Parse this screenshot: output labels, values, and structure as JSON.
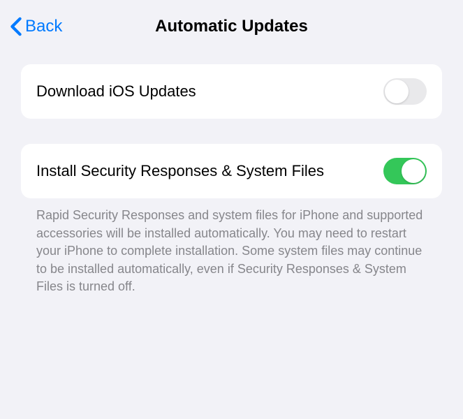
{
  "nav": {
    "back_label": "Back",
    "title": "Automatic Updates"
  },
  "groups": [
    {
      "rows": [
        {
          "label": "Download iOS Updates",
          "toggle": false
        }
      ]
    },
    {
      "rows": [
        {
          "label": "Install Security Responses & System Files",
          "toggle": true
        }
      ],
      "footer": "Rapid Security Responses and system files for iPhone and supported accessories will be installed automatically. You may need to restart your iPhone to complete installation. Some system files may continue to be installed automatically, even if Security Responses & System Files is turned off."
    }
  ]
}
